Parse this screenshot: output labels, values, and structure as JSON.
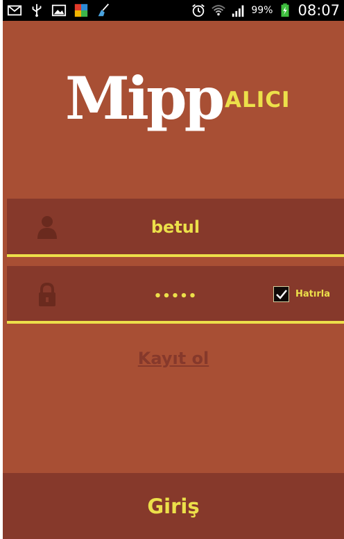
{
  "status_bar": {
    "icons": [
      "mail-icon",
      "usb-icon",
      "image-icon",
      "app-icon",
      "broom-icon",
      "alarm-icon",
      "wifi-icon",
      "signal-icon",
      "battery-charging-icon"
    ],
    "battery_percent": "99%",
    "time": "08:07"
  },
  "logo": {
    "main": "Mipp",
    "sub": "ALICI"
  },
  "login": {
    "username_value": "betul",
    "password_value": "•••••",
    "remember_label": "Hatırla",
    "remember_checked": true,
    "register_link": "Kayıt ol",
    "submit_label": "Giriş"
  },
  "colors": {
    "background": "#a84f34",
    "field_background": "#86392b",
    "accent": "#ece04a",
    "text_light": "#ffffff"
  }
}
